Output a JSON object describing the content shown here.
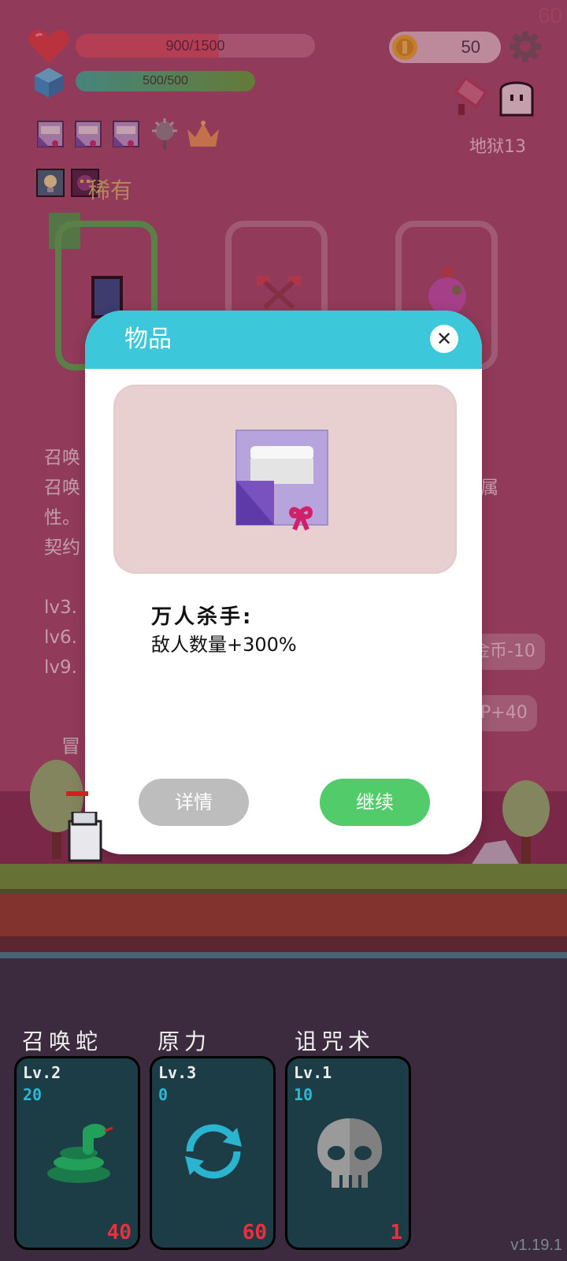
{
  "hud": {
    "fps": "60",
    "hp_text": "900/1500",
    "hp": 900,
    "hp_max": 1500,
    "mana_text": "500/500",
    "coins": "50",
    "dungeon_level": "地狱13"
  },
  "colors": {
    "hp_fill": "#d94f5f",
    "mana_fill_start": "#26c0a0",
    "mana_fill_end": "#58b030",
    "modal_header": "#3cc8da",
    "continue_button": "#52cc6a",
    "detail_button": "#bdbdbd"
  },
  "background": {
    "rarity_label": "稀有",
    "desc_lines": [
      "召唤",
      "召唤",
      "性。",
      "契约"
    ],
    "desc_suffix_line": "属",
    "level_lines": [
      "lv3.",
      "lv6.",
      "lv9."
    ],
    "pill_1": "金币-10",
    "pill_2": "P+40",
    "adventure_label": "冒"
  },
  "modal": {
    "title": "物品",
    "item_icon": "gift-scroll-icon",
    "item_name": "万人杀手:",
    "item_effect": "敌人数量+300%",
    "detail_button": "详情",
    "continue_button": "继续"
  },
  "skills": [
    {
      "name": "召唤蛇",
      "level": "Lv.2",
      "count": "20",
      "cost": "40",
      "icon": "snake-icon"
    },
    {
      "name": "原力",
      "level": "Lv.3",
      "count": "0",
      "cost": "60",
      "icon": "cycle-icon"
    },
    {
      "name": "诅咒术",
      "level": "Lv.1",
      "count": "10",
      "cost": "1",
      "icon": "skull-icon"
    }
  ],
  "version": "v1.19.1"
}
